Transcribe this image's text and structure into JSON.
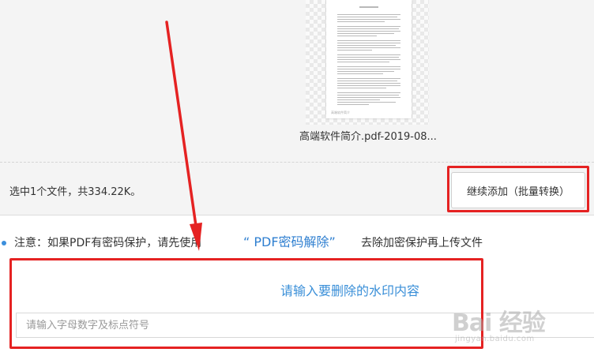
{
  "upload": {
    "file": {
      "name": "高端软件简介.pdf-2019-08...",
      "thumbnail_footer": "高端软件简介"
    },
    "summary": "选中1个文件，共334.22K。",
    "add_more_button": "继续添加（批量转换）"
  },
  "notice": {
    "text_before": "注意：如果PDF有密码保护，请先使用",
    "link": "“ PDF密码解除”",
    "text_after": "去除加密保护再上传文件"
  },
  "watermark": {
    "title": "请输入要删除的水印内容",
    "input_value": "",
    "input_placeholder": "请输入字母数字及标点符号"
  },
  "annotations": {
    "color": "#e52222"
  },
  "site_watermark": {
    "logo": "Bai 经验",
    "url": "jingyan.baidu.com"
  }
}
